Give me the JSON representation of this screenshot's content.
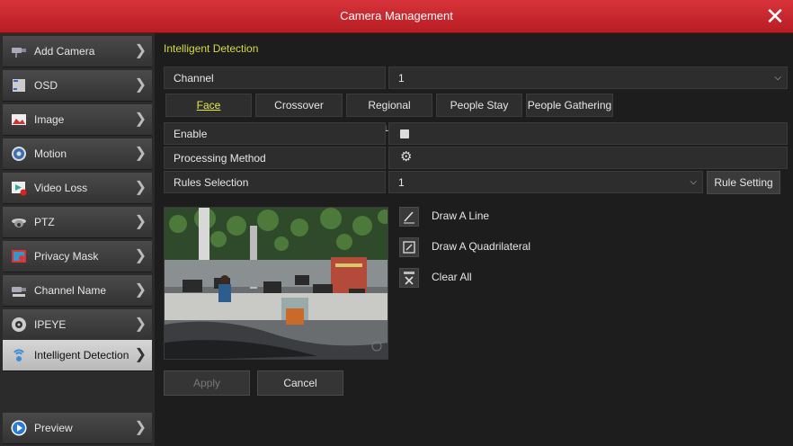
{
  "window": {
    "title": "Camera Management"
  },
  "sidebar": {
    "items": [
      {
        "label": "Add Camera"
      },
      {
        "label": "OSD"
      },
      {
        "label": "Image"
      },
      {
        "label": "Motion"
      },
      {
        "label": "Video Loss"
      },
      {
        "label": "PTZ"
      },
      {
        "label": "Privacy Mask"
      },
      {
        "label": "Channel Name"
      },
      {
        "label": "IPEYE"
      },
      {
        "label": "Intelligent Detection"
      }
    ],
    "footer": {
      "label": "Preview"
    },
    "active_index": 9
  },
  "main": {
    "section_title": "Intelligent Detection",
    "channel": {
      "label": "Channel",
      "value": "1"
    },
    "tabs": [
      {
        "label": "Face"
      },
      {
        "label": "Crossover"
      },
      {
        "label": "Regional Intrusion"
      },
      {
        "label": "People Stay"
      },
      {
        "label": "People Gathering"
      }
    ],
    "active_tab": "Face",
    "enable": {
      "label": "Enable",
      "checked": true
    },
    "processing_method": {
      "label": "Processing Method"
    },
    "rules_selection": {
      "label": "Rules Selection",
      "value": "1"
    },
    "rule_setting_button": "Rule Setting",
    "tools": [
      {
        "label": "Draw A Line",
        "icon": "draw-line-icon"
      },
      {
        "label": "Draw A Quadrilateral",
        "icon": "draw-quadrilateral-icon"
      },
      {
        "label": "Clear All",
        "icon": "clear-all-icon"
      }
    ],
    "apply_button": "Apply",
    "cancel_button": "Cancel"
  },
  "colors": {
    "title_bar": "#c8232b",
    "active_tab_text": "#e8e84a",
    "section_title": "#d8d84a"
  }
}
